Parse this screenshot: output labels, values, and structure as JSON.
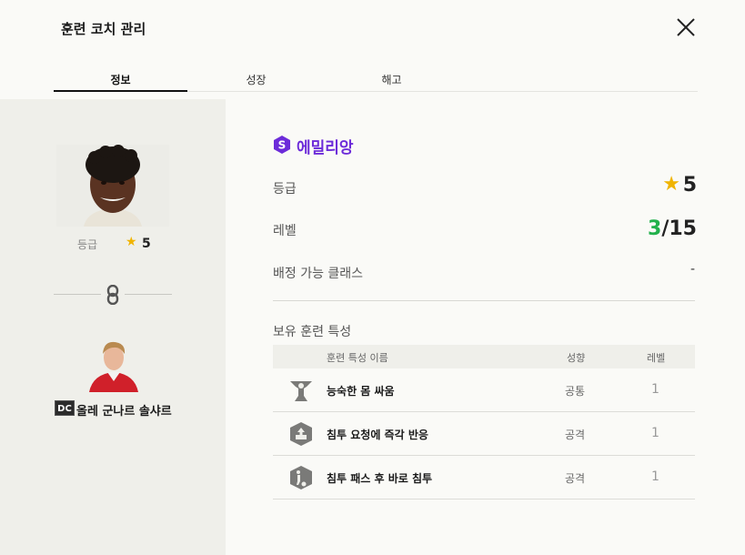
{
  "header": {
    "title": "훈련 코치 관리"
  },
  "tabs": [
    {
      "label": "정보",
      "active": true
    },
    {
      "label": "성장",
      "active": false
    },
    {
      "label": "해고",
      "active": false
    }
  ],
  "left": {
    "grade_label": "등급",
    "grade_value": "5",
    "coach_badge": "DC",
    "coach_name": "올레 군나르 솔샤르"
  },
  "player": {
    "name": "에밀리앙",
    "badge_letter": "S",
    "accent_color": "#6c2bd9",
    "grade_label": "등급",
    "grade_value": "5",
    "level_label": "레벨",
    "level_current": "3",
    "level_max": "/15",
    "assign_label": "배정 가능 클래스",
    "assign_value": "-"
  },
  "traits": {
    "title": "보유 훈련 특성",
    "headers": {
      "name": "훈련 특성 이름",
      "type": "성향",
      "level": "레벨"
    },
    "rows": [
      {
        "icon": "wrestle-icon",
        "name": "능숙한 몸 싸움",
        "type": "공통",
        "level": "1"
      },
      {
        "icon": "request-icon",
        "name": "침투 요청에 즉각 반응",
        "type": "공격",
        "level": "1"
      },
      {
        "icon": "pass-run-icon",
        "name": "침투 패스 후 바로 침투",
        "type": "공격",
        "level": "1"
      }
    ]
  }
}
